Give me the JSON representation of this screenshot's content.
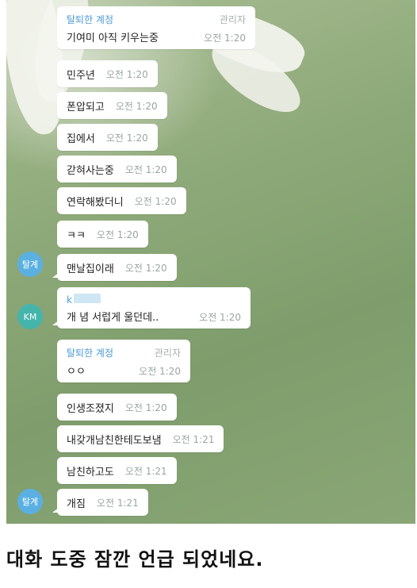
{
  "chat": {
    "messages": [
      {
        "sender": "탈퇴한 계정",
        "role": "관리자",
        "text": "기여미 아직 키우는중",
        "time": "오전 1:20"
      },
      {
        "text": "민주년",
        "time": "오전 1:20"
      },
      {
        "text": "폰압되고",
        "time": "오전 1:20"
      },
      {
        "text": "집에서",
        "time": "오전 1:20"
      },
      {
        "text": "갇혀사는중",
        "time": "오전 1:20"
      },
      {
        "text": "연락해봤더니",
        "time": "오전 1:20"
      },
      {
        "text": "ㅋㅋ",
        "time": "오전 1:20"
      },
      {
        "text": "맨날집이래",
        "time": "오전 1:20"
      },
      {
        "sender": "k",
        "text": "개 념 서럽게 울던데..",
        "time": "오전 1:20"
      },
      {
        "sender": "탈퇴한 계정",
        "role": "관리자",
        "text": "ㅇㅇ",
        "time": "오전 1:20"
      },
      {
        "text": "인생조졌지",
        "time": "오전 1:20"
      },
      {
        "text": "내갖개남친한테도보냄",
        "time": "오전 1:21"
      },
      {
        "text": "남친하고도",
        "time": "오전 1:21"
      },
      {
        "text": "개짐",
        "time": "오전 1:21"
      }
    ],
    "avatars": [
      {
        "label": "탈계",
        "color": "#5bb0e2"
      },
      {
        "label": "KM",
        "color": "#45b5ac"
      },
      {
        "label": "탈계",
        "color": "#5bb0e2"
      }
    ]
  },
  "caption": "대화 도중 잠깐 언급 되었네요."
}
